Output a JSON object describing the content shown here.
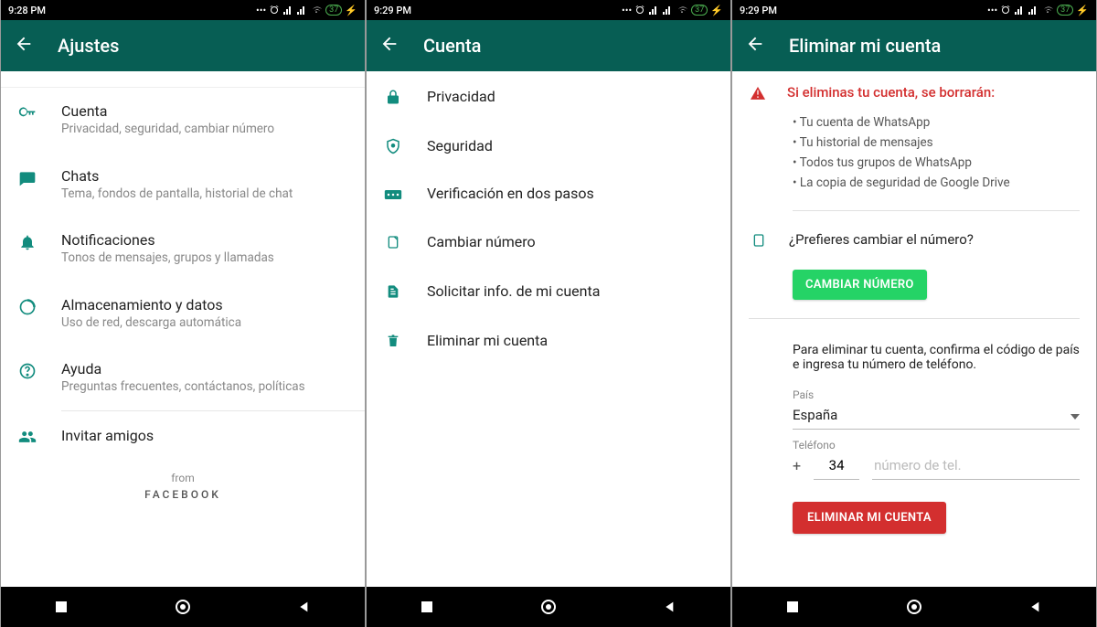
{
  "status": {
    "time1": "9:28 PM",
    "time2": "9:29 PM",
    "time3": "9:29 PM",
    "battery": "37"
  },
  "screen1": {
    "title": "Ajustes",
    "items": [
      {
        "icon": "key",
        "title": "Cuenta",
        "sub": "Privacidad, seguridad, cambiar número"
      },
      {
        "icon": "chat",
        "title": "Chats",
        "sub": "Tema, fondos de pantalla, historial de chat"
      },
      {
        "icon": "bell",
        "title": "Notificaciones",
        "sub": "Tonos de mensajes, grupos y llamadas"
      },
      {
        "icon": "data",
        "title": "Almacenamiento y datos",
        "sub": "Uso de red, descarga automática"
      },
      {
        "icon": "help",
        "title": "Ayuda",
        "sub": "Preguntas frecuentes, contáctanos, políticas"
      },
      {
        "icon": "invite",
        "title": "Invitar amigos",
        "sub": ""
      }
    ],
    "from": "from",
    "brand": "FACEBOOK"
  },
  "screen2": {
    "title": "Cuenta",
    "items": [
      {
        "icon": "lock",
        "title": "Privacidad"
      },
      {
        "icon": "shield",
        "title": "Seguridad"
      },
      {
        "icon": "twostep",
        "title": "Verificación en dos pasos"
      },
      {
        "icon": "changenum",
        "title": "Cambiar número"
      },
      {
        "icon": "request",
        "title": "Solicitar info. de mi cuenta"
      },
      {
        "icon": "delete",
        "title": "Eliminar mi cuenta"
      }
    ]
  },
  "screen3": {
    "title": "Eliminar mi cuenta",
    "warn_title": "Si eliminas tu cuenta, se borrarán:",
    "warn_items": [
      "Tu cuenta de WhatsApp",
      "Tu historial de mensajes",
      "Todos tus grupos de WhatsApp",
      "La copia de seguridad de Google Drive"
    ],
    "change_q": "¿Prefieres cambiar el número?",
    "change_btn": "CAMBIAR NÚMERO",
    "confirm_text": "Para eliminar tu cuenta, confirma el código de país e ingresa tu número de teléfono.",
    "country_label": "País",
    "country": "España",
    "phone_label": "Teléfono",
    "plus": "+",
    "code": "34",
    "phone_placeholder": "número de tel.",
    "delete_btn": "ELIMINAR MI CUENTA"
  }
}
